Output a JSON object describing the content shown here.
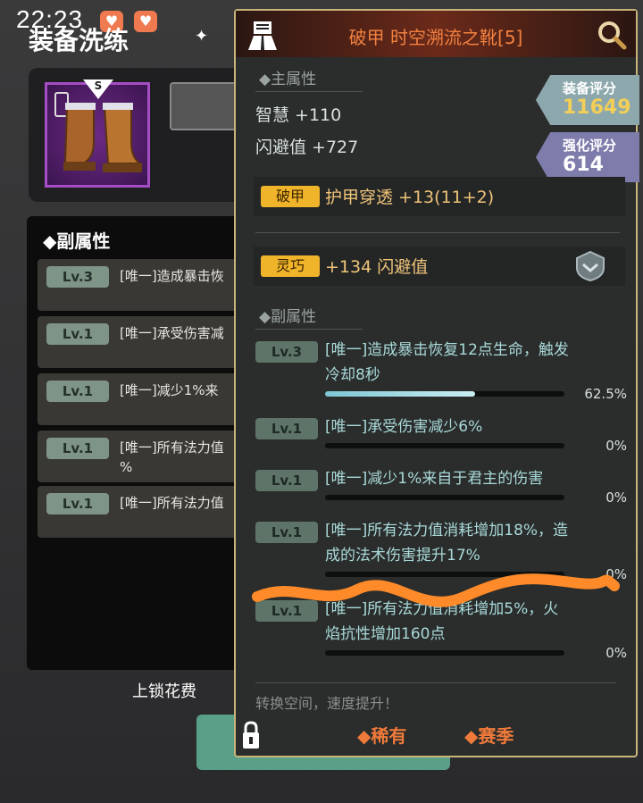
{
  "status": {
    "time": "22:23"
  },
  "left": {
    "title": "装备洗练",
    "sub_title": "◆副属性",
    "lock_cost": "上锁花费",
    "rows": [
      {
        "lv": "Lv.3",
        "text": "[唯一]造成暴击恢",
        "text2": ""
      },
      {
        "lv": "Lv.1",
        "text": "[唯一]承受伤害减",
        "text2": ""
      },
      {
        "lv": "Lv.1",
        "text": "[唯一]减少1%来",
        "text2": ""
      },
      {
        "lv": "Lv.1",
        "text": "[唯一]所有法力值",
        "text2": "%"
      },
      {
        "lv": "Lv.1",
        "text": "[唯一]所有法力值",
        "text2": ""
      }
    ]
  },
  "popup": {
    "title": "破甲 时空溯流之靴[5]",
    "main_label": "◆主属性",
    "main_attrs": [
      "智慧 +110",
      "闪避值 +727"
    ],
    "equip_score_label": "装备评分",
    "equip_score": "11649",
    "enhance_score_label": "强化评分",
    "enhance_score": "614",
    "effects": [
      {
        "tag": "破甲",
        "text": "护甲穿透 +13(11+2)"
      },
      {
        "tag": "灵巧",
        "text": "+134 闪避值"
      }
    ],
    "sub_label": "◆副属性",
    "subs": [
      {
        "lv": "Lv.3",
        "lines": [
          "[唯一]造成暴击恢复12点生命，触发",
          "冷却8秒"
        ],
        "pct": "62.5%",
        "progress": 0.625
      },
      {
        "lv": "Lv.1",
        "lines": [
          "[唯一]承受伤害减少6%"
        ],
        "pct": "0%",
        "progress": 0
      },
      {
        "lv": "Lv.1",
        "lines": [
          "[唯一]减少1%来自于君主的伤害"
        ],
        "pct": "0%",
        "progress": 0
      },
      {
        "lv": "Lv.1",
        "lines": [
          "[唯一]所有法力值消耗增加18%，造",
          "成的法术伤害提升17%"
        ],
        "pct": "0%",
        "progress": 0
      },
      {
        "lv": "Lv.1",
        "lines": [
          "[唯一]所有法力值消耗增加5%，火",
          "焰抗性增加160点"
        ],
        "pct": "0%",
        "progress": 0
      }
    ],
    "footer": "转换空间，速度提升！",
    "tag_rare": "◆稀有",
    "tag_season": "◆赛季"
  },
  "colors": {
    "accent": "#f07a3a",
    "score_gold": "#f3cf57",
    "progress": "#7ec6d4"
  }
}
